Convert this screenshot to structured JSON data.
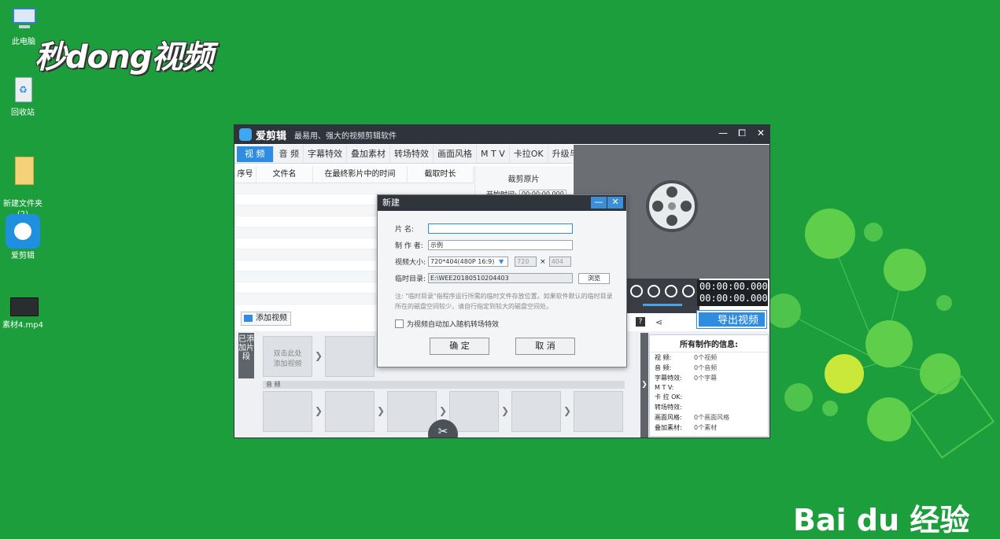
{
  "desktop": {
    "icons": [
      {
        "label": "此电脑"
      },
      {
        "label": "回收站"
      },
      {
        "label": "新建文件夹\n(2)"
      },
      {
        "label": "爱剪辑"
      },
      {
        "label": "素材4.mp4"
      }
    ],
    "watermark": "秒dong视频",
    "baidu_logo": "Bai du 经验"
  },
  "app": {
    "name": "爱剪辑",
    "slogan": "最易用、强大的视频剪辑软件",
    "tabs": [
      "视 频",
      "音 频",
      "字幕特效",
      "叠加素材",
      "转场特效",
      "画面风格",
      "M T V",
      "卡拉OK",
      "升级与服务"
    ],
    "active_tab": "视 频",
    "columns": [
      "序号",
      "文件名",
      "在最终影片中的时间",
      "截取时长"
    ],
    "trim_panel": {
      "title": "裁剪原片",
      "start_label": "开始时间:",
      "start_value": "00:00:00.000"
    },
    "timecode_current": "00:00:00.000",
    "timecode_total": "00:00:00.000",
    "add_video_label": "添加视频",
    "export_label": "导出视频",
    "added_clips_label": "已添加片段",
    "first_clip_hint": "双击此处\n添加视频",
    "audio_label": "音 频",
    "info": {
      "title": "所有制作的信息:",
      "rows": [
        {
          "k": "视      频:",
          "v": "0个视频"
        },
        {
          "k": "音      频:",
          "v": "0个音频"
        },
        {
          "k": "字幕特效:",
          "v": "0个字幕"
        },
        {
          "k": "M  T  V:",
          "v": ""
        },
        {
          "k": "卡 拉 OK:",
          "v": ""
        },
        {
          "k": "转场特效:",
          "v": ""
        },
        {
          "k": "画面风格:",
          "v": "0个画面风格"
        },
        {
          "k": "叠加素材:",
          "v": "0个素材"
        }
      ]
    }
  },
  "dialog": {
    "title": "新建",
    "film_name_label": "片    名:",
    "film_name_value": "",
    "author_label": "制 作 者:",
    "author_value": "示例",
    "size_label": "视频大小:",
    "size_value": "720*404(480P 16:9)",
    "width_value": "720",
    "height_value": "404",
    "times": "×",
    "temp_label": "临时目录:",
    "temp_value": "E:\\WEE20180510204403",
    "browse_label": "浏览",
    "note": "注: \"临时目录\"指程序运行所需的临时文件存放位置。如果软件默认的临时目录所在的磁盘空间较少，请自行指定到较大的磁盘空间处。",
    "checkbox_label": "为视频自动加入随机转场特效",
    "ok_label": "确 定",
    "cancel_label": "取 消",
    "minimize": "—",
    "close": "✕"
  },
  "window_controls": {
    "minimize": "—",
    "maximize": "⧠",
    "close": "✕"
  },
  "colors": {
    "desktop": "#1c9e3c",
    "accent": "#2e8de2",
    "titlebar": "#2f333b"
  }
}
